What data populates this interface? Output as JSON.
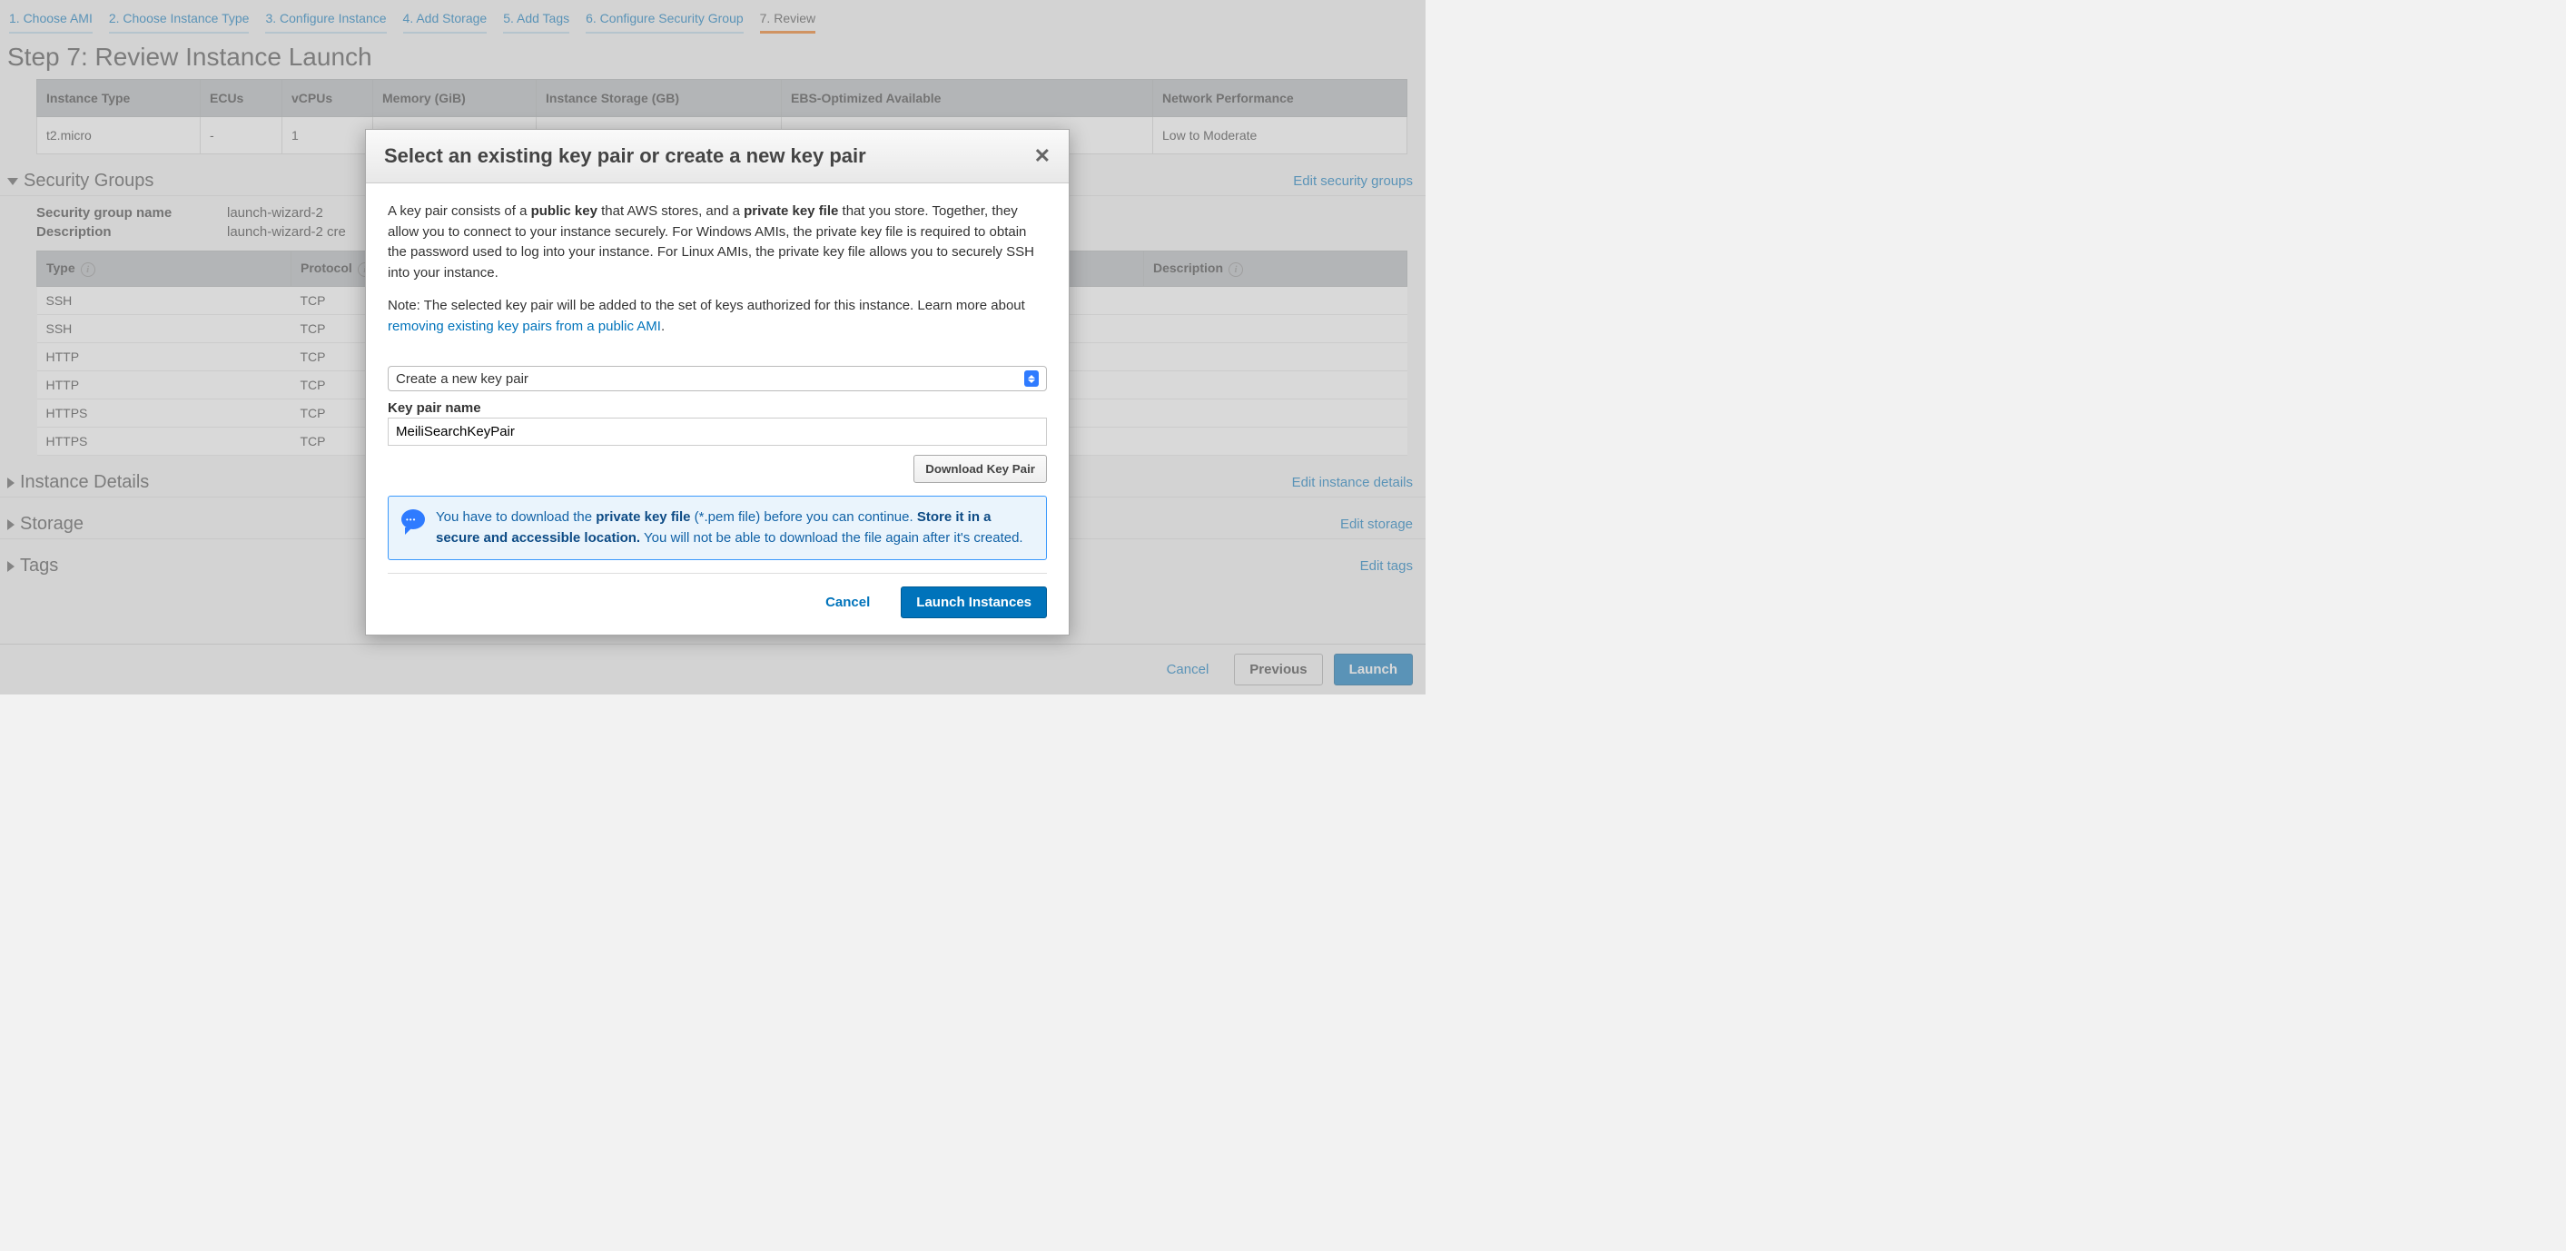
{
  "tabs": [
    {
      "label": "1. Choose AMI"
    },
    {
      "label": "2. Choose Instance Type"
    },
    {
      "label": "3. Configure Instance"
    },
    {
      "label": "4. Add Storage"
    },
    {
      "label": "5. Add Tags"
    },
    {
      "label": "6. Configure Security Group"
    },
    {
      "label": "7. Review"
    }
  ],
  "step_title": "Step 7: Review Instance Launch",
  "instance_table": {
    "headers": [
      "Instance Type",
      "ECUs",
      "vCPUs",
      "Memory (GiB)",
      "Instance Storage (GB)",
      "EBS-Optimized Available",
      "Network Performance"
    ],
    "row": [
      "t2.micro",
      "-",
      "1",
      "",
      "",
      "",
      "Low to Moderate"
    ]
  },
  "sections": {
    "security": {
      "title": "Security Groups",
      "edit": "Edit security groups"
    },
    "instance_details": {
      "title": "Instance Details",
      "edit": "Edit instance details"
    },
    "storage": {
      "title": "Storage",
      "edit": "Edit storage"
    },
    "tags": {
      "title": "Tags",
      "edit": "Edit tags"
    }
  },
  "sg": {
    "name_label": "Security group name",
    "name_value": "launch-wizard-2",
    "desc_label": "Description",
    "desc_value": "launch-wizard-2 cre"
  },
  "rules": {
    "headers": [
      "Type",
      "Protocol",
      "Description"
    ],
    "rows": [
      [
        "SSH",
        "TCP"
      ],
      [
        "SSH",
        "TCP"
      ],
      [
        "HTTP",
        "TCP"
      ],
      [
        "HTTP",
        "TCP"
      ],
      [
        "HTTPS",
        "TCP"
      ],
      [
        "HTTPS",
        "TCP"
      ]
    ]
  },
  "footer": {
    "cancel": "Cancel",
    "previous": "Previous",
    "launch": "Launch"
  },
  "modal": {
    "title": "Select an existing key pair or create a new key pair",
    "p1_a": "A key pair consists of a ",
    "p1_b": "public key",
    "p1_c": " that AWS stores, and a ",
    "p1_d": "private key file",
    "p1_e": " that you store. Together, they allow you to connect to your instance securely. For Windows AMIs, the private key file is required to obtain the password used to log into your instance. For Linux AMIs, the private key file allows you to securely SSH into your instance.",
    "p2_a": "Note: The selected key pair will be added to the set of keys authorized for this instance. Learn more about ",
    "p2_link": "removing existing key pairs from a public AMI",
    "p2_b": ".",
    "select_value": "Create a new key pair",
    "kp_label": "Key pair name",
    "kp_value": "MeiliSearchKeyPair",
    "download": "Download Key Pair",
    "info_a": "You have to download the ",
    "info_b": "private key file",
    "info_c": " (*.pem file) before you can continue. ",
    "info_d": "Store it in a secure and accessible location.",
    "info_e": " You will not be able to download the file again after it's created.",
    "cancel": "Cancel",
    "launch": "Launch Instances"
  }
}
